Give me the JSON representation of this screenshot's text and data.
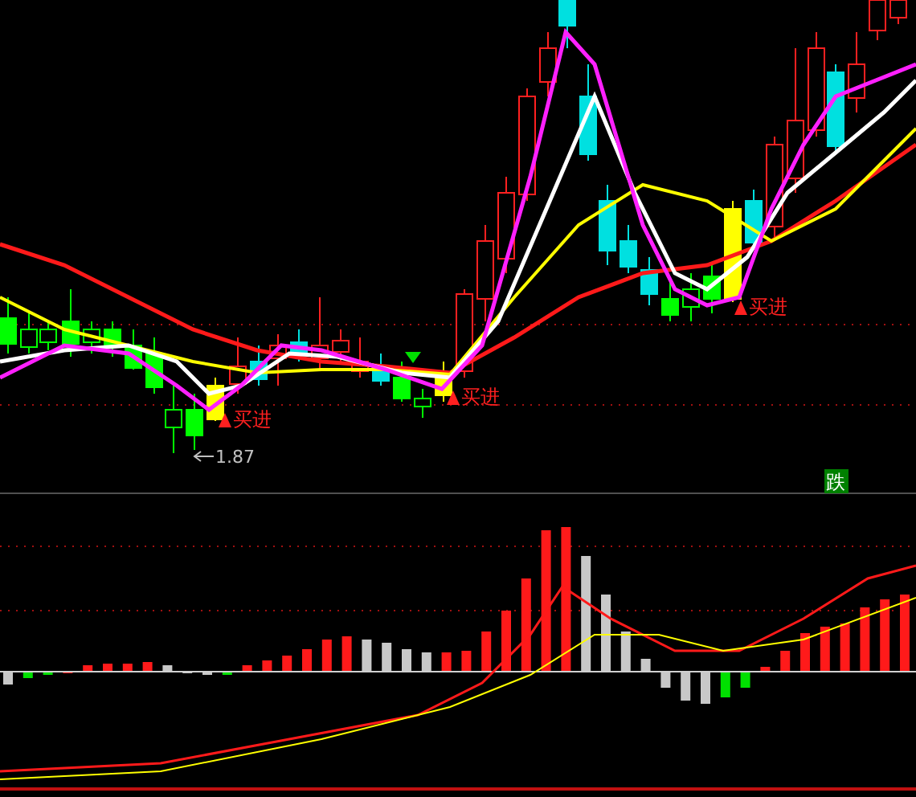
{
  "signals": [
    {
      "label": "买进"
    },
    {
      "label": "买进"
    },
    {
      "label": "买进"
    }
  ],
  "low_marker": {
    "label": "1.87"
  },
  "badge": {
    "label": "跌"
  }
}
